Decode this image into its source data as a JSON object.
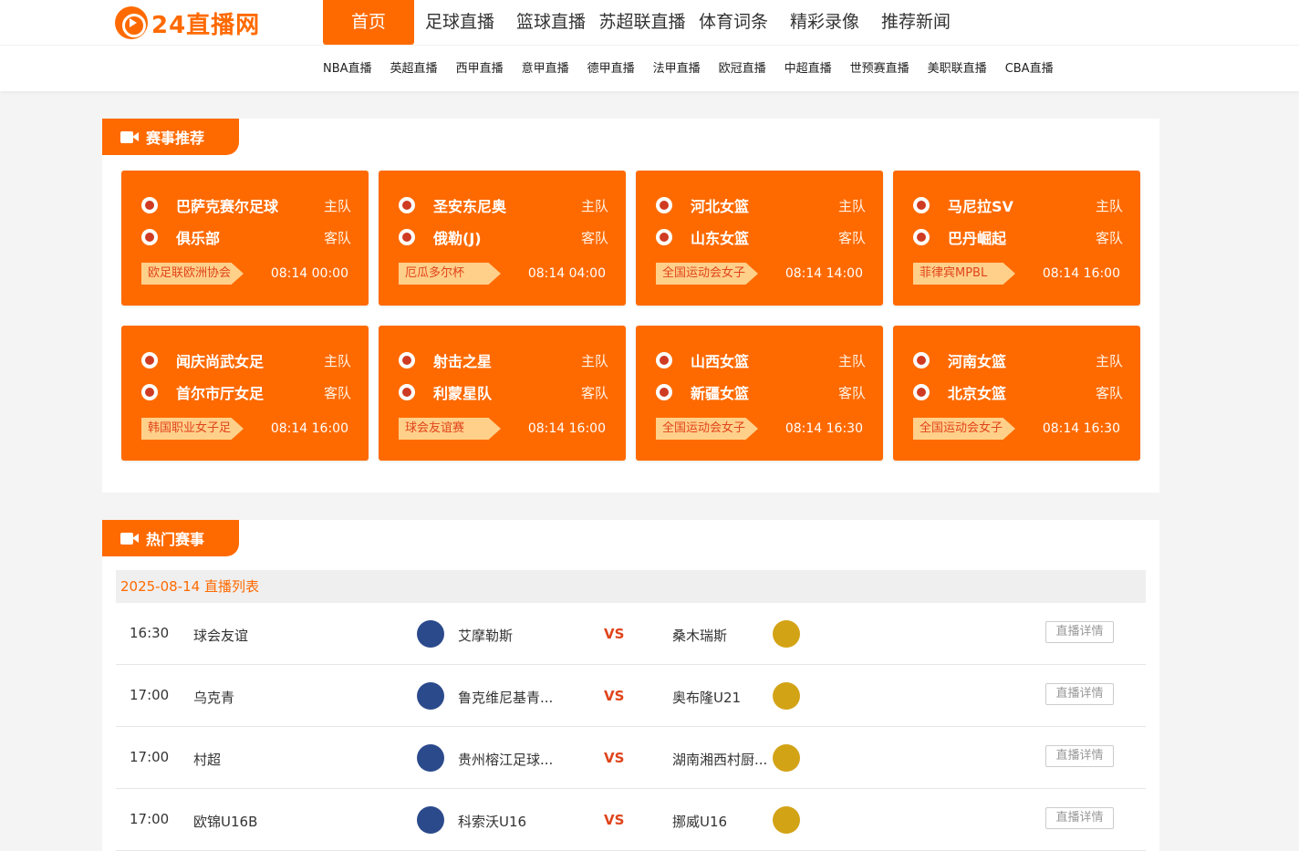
{
  "logo": {
    "text": "24直播网"
  },
  "nav": {
    "main": [
      "首页",
      "足球直播",
      "篮球直播",
      "苏超联直播",
      "体育词条",
      "精彩录像",
      "推荐新闻"
    ],
    "sub": [
      "NBA直播",
      "英超直播",
      "西甲直播",
      "意甲直播",
      "德甲直播",
      "法甲直播",
      "欧冠直播",
      "中超直播",
      "世预赛直播",
      "美职联直播",
      "CBA直播"
    ]
  },
  "recommend": {
    "title": "赛事推荐",
    "home_label": "主队",
    "away_label": "客队",
    "cards": [
      {
        "home": "巴萨克赛尔足球",
        "away": "俱乐部",
        "league": "欧足联欧洲协会",
        "time": "08:14 00:00"
      },
      {
        "home": "圣安东尼奥",
        "away": "俄勒(J)",
        "league": "厄瓜多尔杯",
        "time": "08:14 04:00"
      },
      {
        "home": "河北女篮",
        "away": "山东女篮",
        "league": "全国运动会女子",
        "time": "08:14 14:00"
      },
      {
        "home": "马尼拉SV",
        "away": "巴丹崛起",
        "league": "菲律宾MPBL",
        "time": "08:14 16:00"
      },
      {
        "home": "闻庆尚武女足",
        "away": "首尔市厅女足",
        "league": "韩国职业女子足",
        "time": "08:14 16:00"
      },
      {
        "home": "射击之星",
        "away": "利蒙星队",
        "league": "球会友谊赛",
        "time": "08:14 16:00"
      },
      {
        "home": "山西女篮",
        "away": "新疆女篮",
        "league": "全国运动会女子",
        "time": "08:14 16:30"
      },
      {
        "home": "河南女篮",
        "away": "北京女篮",
        "league": "全国运动会女子",
        "time": "08:14 16:30"
      }
    ]
  },
  "hot": {
    "title": "热门赛事",
    "date_header": "2025-08-14 直播列表",
    "vs_label": "VS",
    "detail_label": "直播详情",
    "rows": [
      {
        "time": "16:30",
        "league": "球会友谊",
        "home": "艾摩勒斯",
        "away": "桑木瑞斯"
      },
      {
        "time": "17:00",
        "league": "乌克青",
        "home": "鲁克维尼基青...",
        "away": "奥布隆U21"
      },
      {
        "time": "17:00",
        "league": "村超",
        "home": "贵州榕江足球...",
        "away": "湖南湘西村厨..."
      },
      {
        "time": "17:00",
        "league": "欧锦U16B",
        "home": "科索沃U16",
        "away": "挪威U16"
      }
    ]
  },
  "colors": {
    "accent": "#ff6a00",
    "tag_bg": "#ffd08a",
    "vs": "#e0441b"
  }
}
